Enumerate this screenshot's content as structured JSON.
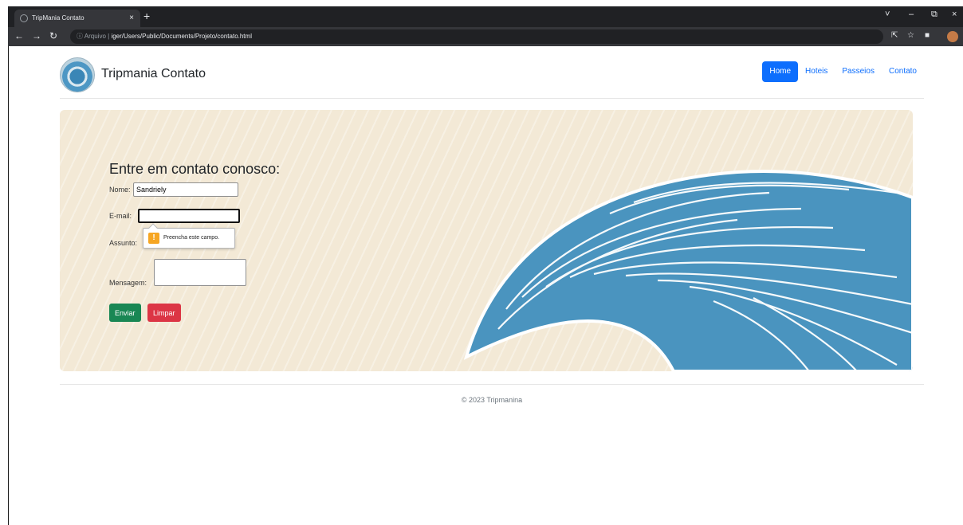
{
  "browser": {
    "tab_title": "TripMania Contato",
    "tab_close": "×",
    "new_tab": "+",
    "address_prefix": "ⓘ Arquivo |",
    "address_path": "iger/Users/Public/Documents/Projeto/contato.html",
    "min": "–",
    "max": "⧉",
    "close": "×",
    "chevron": "˅"
  },
  "header": {
    "brand": "Tripmania Contato",
    "nav": [
      {
        "label": "Home",
        "active": true
      },
      {
        "label": "Hoteis"
      },
      {
        "label": "Passeios"
      },
      {
        "label": "Contato"
      }
    ]
  },
  "form": {
    "title": "Entre em contato conosco:",
    "name_label": "Nome:",
    "name_value": "Sandriely",
    "email_label": "E-mail:",
    "email_value": "",
    "subject_label": "Assunto:",
    "message_label": "Mensagem:",
    "validation_message": "Preencha este campo.",
    "send_label": "Enviar",
    "clear_label": "Limpar"
  },
  "footer": {
    "text": "© 2023 Tripmanina"
  },
  "colors": {
    "primary": "#0d6efd",
    "success": "#198754",
    "danger": "#dc3545",
    "hero_bg": "#f3e9d6",
    "wave": "#4a94bf"
  }
}
